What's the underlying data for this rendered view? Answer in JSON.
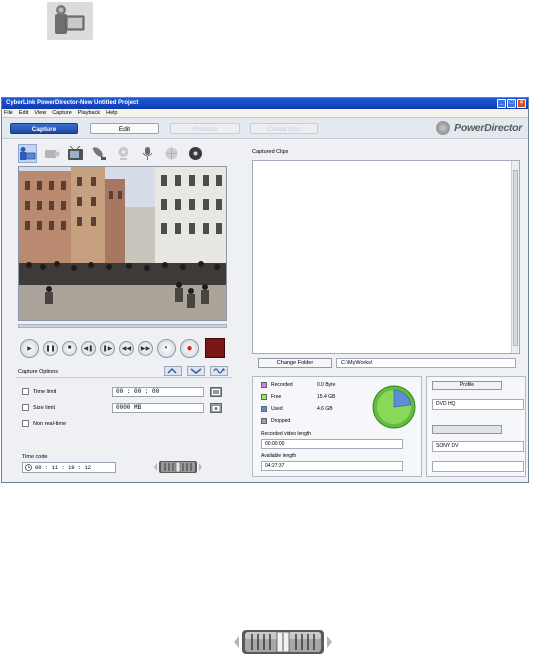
{
  "window": {
    "title": "CyberLink PowerDirector-New Untitled Project"
  },
  "menu": [
    "File",
    "Edit",
    "View",
    "Capture",
    "Playback",
    "Help"
  ],
  "modes": {
    "capture": "Capture",
    "edit": "Edit",
    "produce": "Produce",
    "create_disc": "Create Disc"
  },
  "brand": {
    "name": "PowerDirector"
  },
  "source_icons": [
    "dv-camcorder-icon",
    "hdv-camcorder-icon",
    "tv-icon",
    "satellite-icon",
    "webcam-icon",
    "microphone-icon",
    "internet-icon",
    "disc-icon"
  ],
  "capture_options": {
    "heading": "Capture Options",
    "time_limit": "Time limit",
    "time_limit_value": "00 : 00 : 00",
    "size_limit": "Size limit",
    "size_limit_value": "0000  MB",
    "non_realtime": "Non real-time"
  },
  "timecode": {
    "label": "Time code",
    "value": "00 : 11 : 19 : 12"
  },
  "clips": {
    "label": "Captured Clips"
  },
  "folder": {
    "button": "Change Folder",
    "path": "C:\\MyWorks\\"
  },
  "disk": {
    "recorded_label": "Recorded",
    "recorded_value": "0.0  Byte",
    "free_label": "Free",
    "free_value": "15.4  GB",
    "used_label": "Used",
    "used_value": "4.6  GB",
    "dropped_label": "Dropped",
    "used_fraction": 0.23,
    "colors": {
      "recorded": "#d57be0",
      "free": "#98e65a",
      "used": "#5b8ed6",
      "dropped": "#9c9c9c"
    }
  },
  "recorded_length": {
    "label": "Recorded video length",
    "value": "00:00:00"
  },
  "available_length": {
    "label": "Available length",
    "value": "04:27:37"
  },
  "profile": {
    "button": "Profile",
    "value": "DVD HQ",
    "device_value": "SONY DV"
  }
}
